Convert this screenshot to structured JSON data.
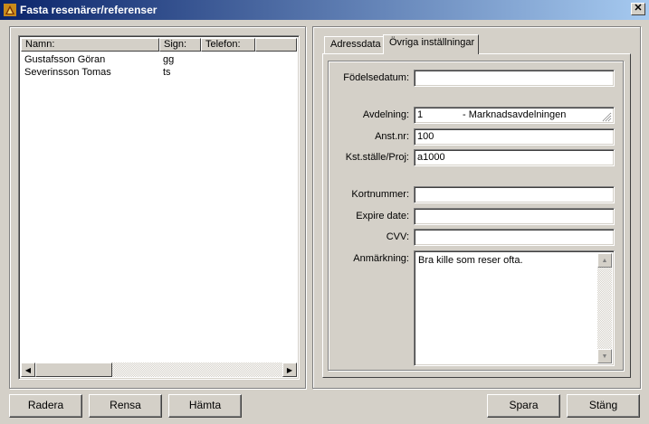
{
  "window": {
    "title": "Fasta resenärer/referenser",
    "close_label": "✕",
    "app_icon": "app-logo-icon"
  },
  "list": {
    "columns": [
      "Namn:",
      "Sign:",
      "Telefon:"
    ],
    "rows": [
      {
        "name": "Gustafsson Göran",
        "sign": "gg",
        "phone": ""
      },
      {
        "name": "Severinsson Tomas",
        "sign": "ts",
        "phone": ""
      }
    ],
    "scroll_left": "◀",
    "scroll_right": "▶"
  },
  "tabs": {
    "addressdata": "Adressdata",
    "other_settings": "Övriga inställningar",
    "active": "other_settings"
  },
  "form": {
    "birthdate_label": "Födelsedatum:",
    "birthdate_value": "",
    "department_label": "Avdelning:",
    "department_code": "1",
    "department_name": "- Marknadsavdelningen",
    "employee_no_label": "Anst.nr:",
    "employee_no_value": "100",
    "cost_center_label": "Kst.ställe/Proj:",
    "cost_center_value": "a1000",
    "card_number_label": "Kortnummer:",
    "card_number_value": "",
    "expire_label": "Expire date:",
    "expire_value": "",
    "cvv_label": "CVV:",
    "cvv_value": "",
    "remark_label": "Anmärkning:",
    "remark_value": "Bra kille som reser ofta.",
    "scroll_up": "▲",
    "scroll_down": "▼"
  },
  "buttons": {
    "delete": "Radera",
    "clear": "Rensa",
    "fetch": "Hämta",
    "save": "Spara",
    "close": "Stäng"
  }
}
